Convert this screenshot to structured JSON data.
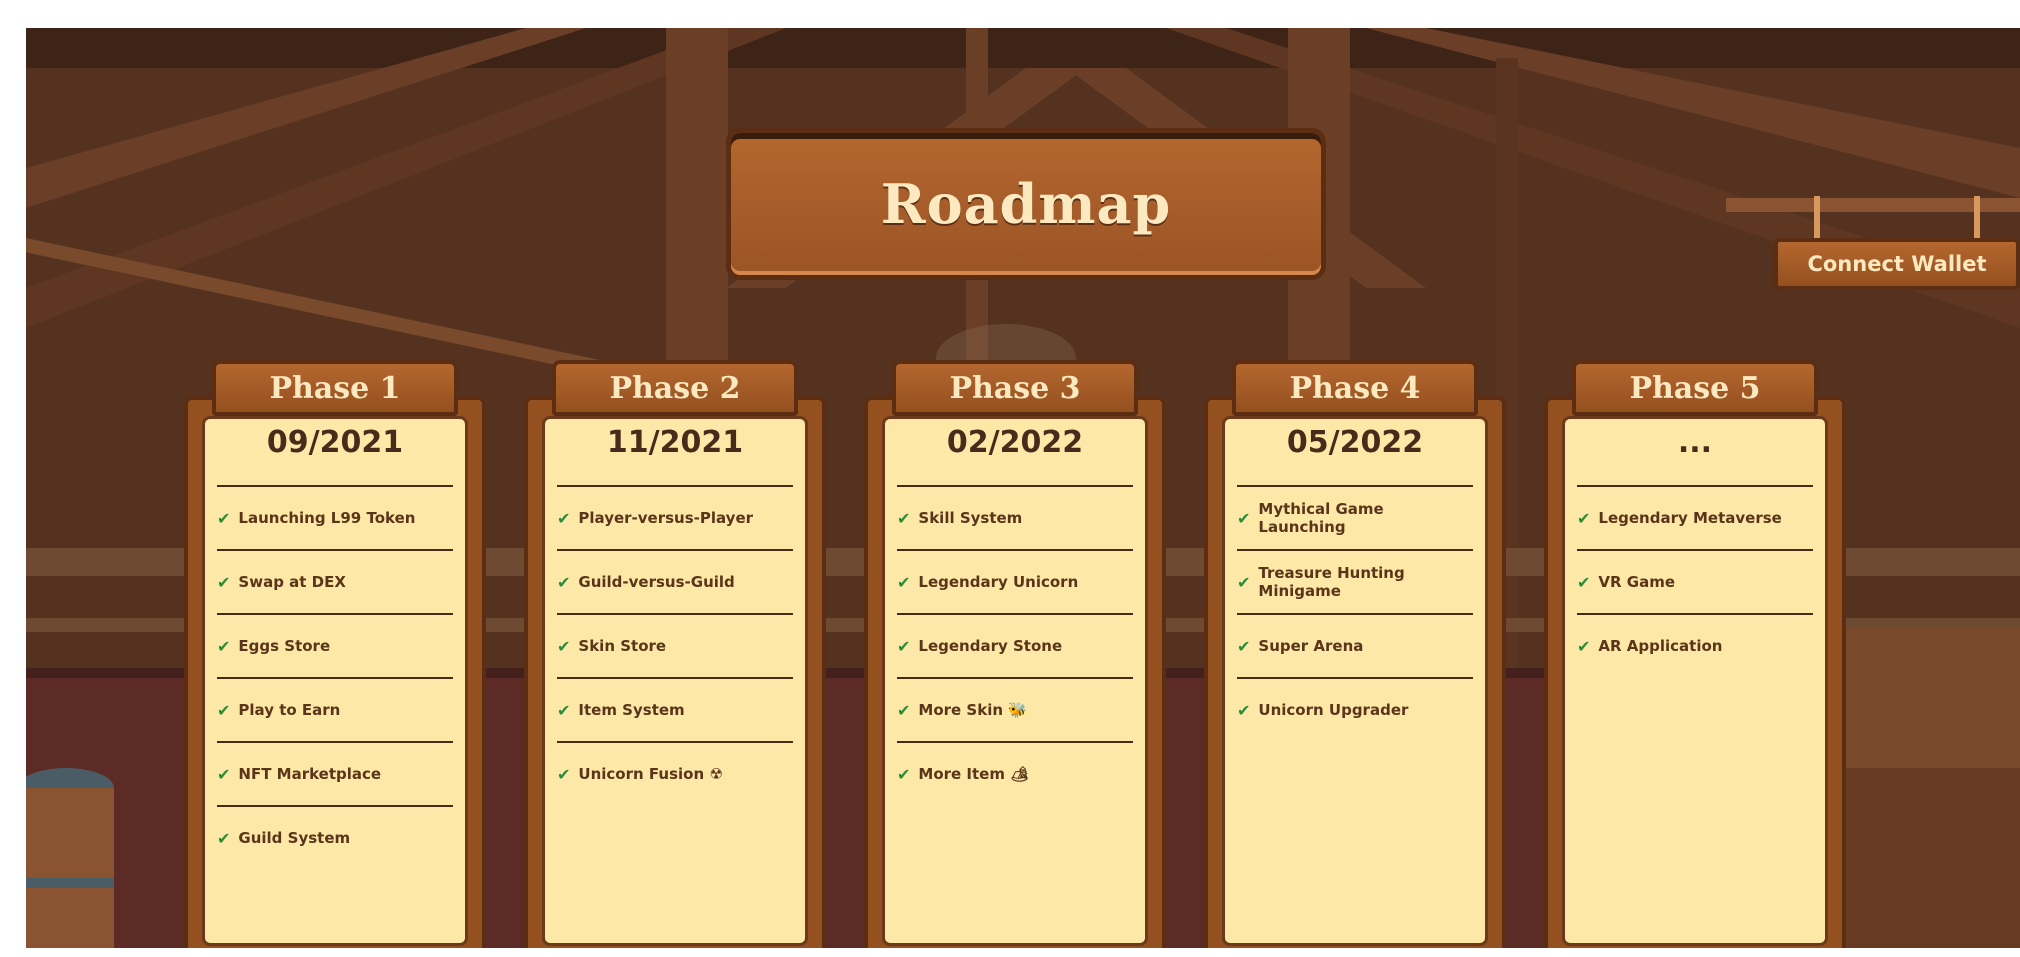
{
  "header": {
    "title": "Roadmap",
    "connect_wallet_label": "Connect Wallet"
  },
  "phases": [
    {
      "label": "Phase 1",
      "date": "09/2021",
      "items": [
        "Launching L99 Token",
        "Swap at DEX",
        "Eggs Store",
        "Play to Earn",
        "NFT Marketplace",
        "Guild System"
      ]
    },
    {
      "label": "Phase 2",
      "date": "11/2021",
      "items": [
        "Player-versus-Player",
        "Guild-versus-Guild",
        "Skin Store",
        "Item System",
        "Unicorn Fusion ☢"
      ]
    },
    {
      "label": "Phase 3",
      "date": "02/2022",
      "items": [
        "Skill System",
        "Legendary Unicorn",
        "Legendary Stone",
        "More Skin 🐝",
        "More Item 🏕"
      ]
    },
    {
      "label": "Phase 4",
      "date": "05/2022",
      "items": [
        "Mythical Game Launching",
        "Treasure Hunting Minigame",
        "Super Arena",
        "Unicorn Upgrader"
      ]
    },
    {
      "label": "Phase 5",
      "date": "...",
      "items": [
        "Legendary Metaverse",
        "VR Game",
        "AR Application"
      ]
    }
  ],
  "icons": {
    "check": "check-icon"
  },
  "colors": {
    "paper": "#fee8a8",
    "wood": "#94501f",
    "wood_dark": "#5b2e14",
    "check": "#2e8b3a",
    "text": "#5a3519"
  }
}
